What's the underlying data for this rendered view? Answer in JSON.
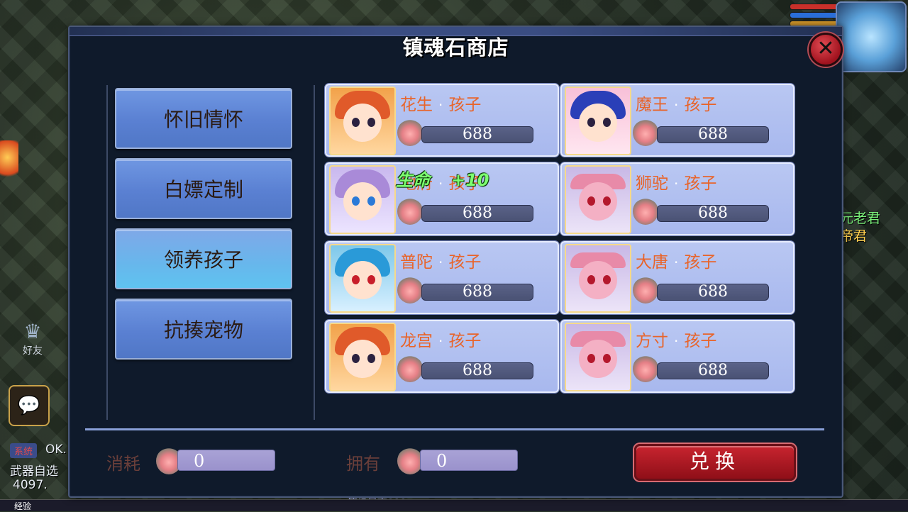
{
  "background": {
    "friend_label": "好友",
    "chat_icon": "chat-bubble-icon",
    "left_lines": [
      "OK.",
      "武器自选",
      "4097."
    ],
    "left_badge": "系统",
    "right_lines": [
      "元老君",
      "帝君"
    ],
    "bottom_text": "等级最高888",
    "exp_label": "经验"
  },
  "shop": {
    "title": "镇魂石商店",
    "close_icon": "close-x-icon",
    "menu": [
      {
        "label": "怀旧情怀",
        "active": false
      },
      {
        "label": "白嫖定制",
        "active": false
      },
      {
        "label": "领养孩子",
        "active": true
      },
      {
        "label": "抗揍宠物",
        "active": false
      }
    ],
    "items": [
      {
        "name": "花生",
        "suffix": "孩子",
        "price": "688",
        "portrait": "girl-orange-hair"
      },
      {
        "name": "魔王",
        "suffix": "孩子",
        "price": "688",
        "portrait": "girl-blue-hair"
      },
      {
        "name": "地府",
        "suffix": "孩子",
        "price": "688",
        "portrait": "boy-purple-hair"
      },
      {
        "name": "狮驼",
        "suffix": "孩子",
        "price": "688",
        "portrait": "demon-pink"
      },
      {
        "name": "普陀",
        "suffix": "孩子",
        "price": "688",
        "portrait": "girl-teal-hair"
      },
      {
        "name": "大唐",
        "suffix": "孩子",
        "price": "688",
        "portrait": "demon-pink"
      },
      {
        "name": "龙宫",
        "suffix": "孩子",
        "price": "688",
        "portrait": "girl-orange-hair"
      },
      {
        "name": "方寸",
        "suffix": "孩子",
        "price": "688",
        "portrait": "demon-pink"
      }
    ],
    "currency_icon": "soul-stone-pouch-icon",
    "floating": {
      "label": "生命",
      "value": "+10"
    },
    "footer": {
      "cost_label": "消耗",
      "cost_value": "0",
      "owned_label": "拥有",
      "owned_value": "0",
      "exchange_label": "兑换"
    }
  }
}
